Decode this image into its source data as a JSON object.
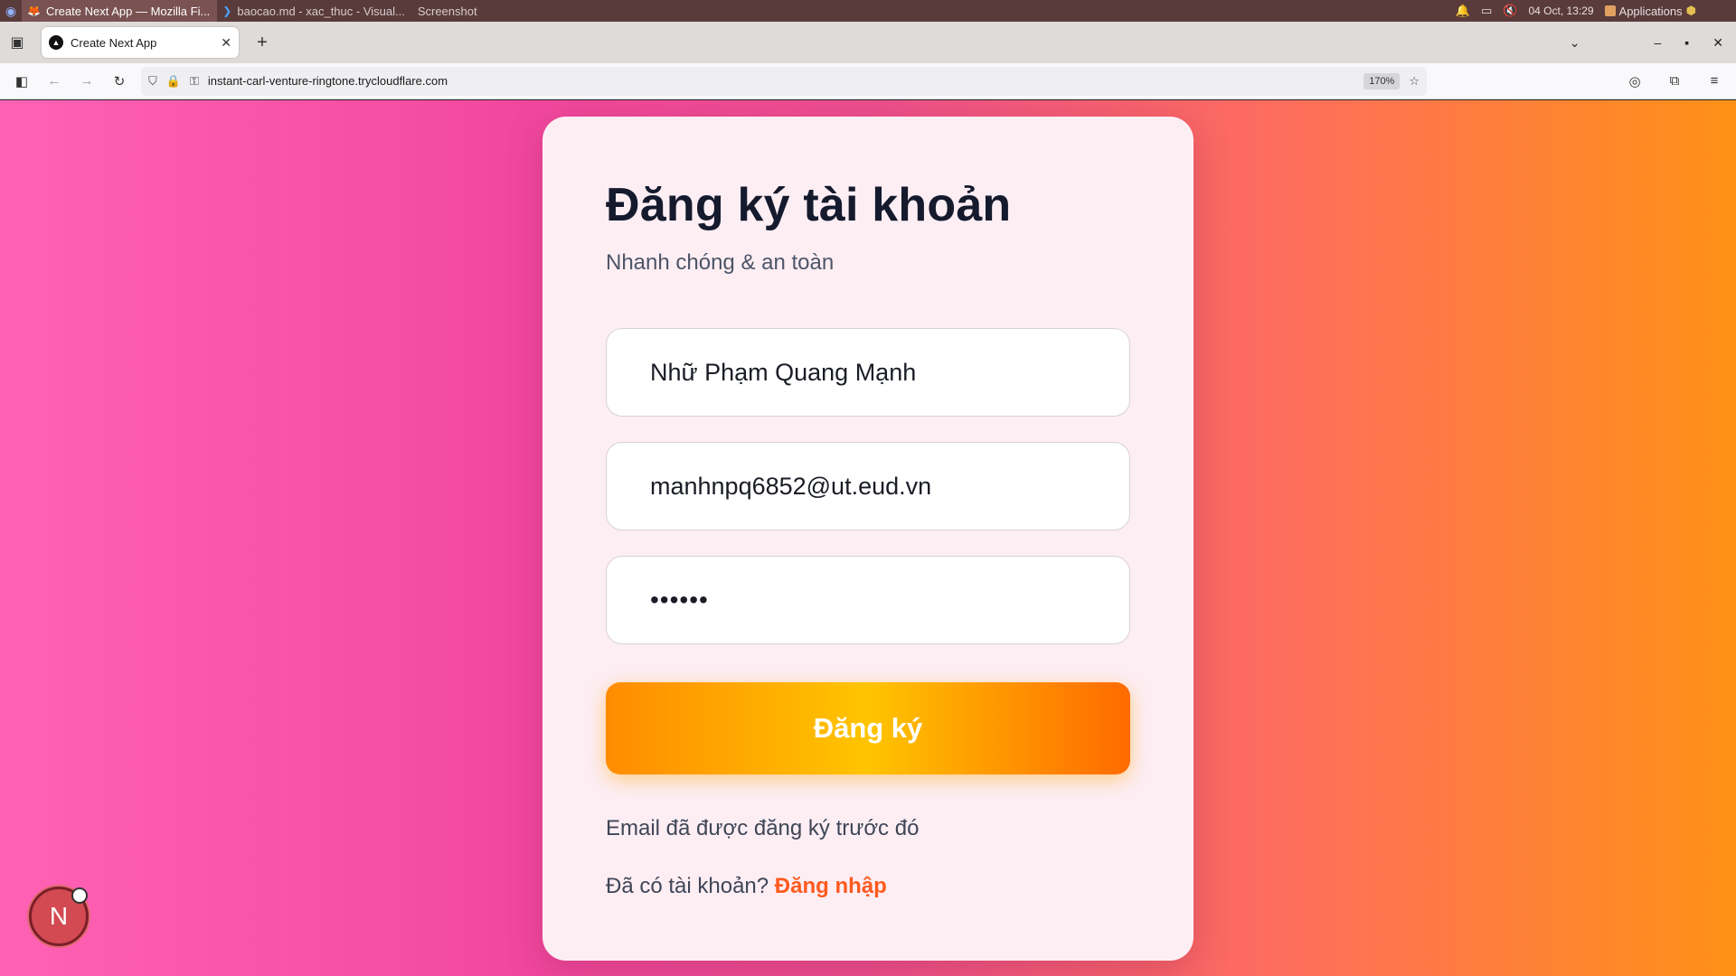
{
  "os_panel": {
    "tasks": [
      {
        "label": "Create Next App — Mozilla Fi...",
        "active": true
      },
      {
        "label": "baocao.md - xac_thuc - Visual...",
        "active": false
      },
      {
        "label": "Screenshot",
        "active": false
      }
    ],
    "datetime": "04 Oct, 13:29",
    "applications_label": "Applications"
  },
  "browser": {
    "tab_title": "Create Next App",
    "tab_favicon": "▲",
    "url": "instant-carl-venture-ringtone.trycloudflare.com",
    "zoom": "170%"
  },
  "form": {
    "title": "Đăng ký tài khoản",
    "subtitle": "Nhanh chóng & an toàn",
    "name_value": "Nhữ Phạm Quang Mạnh",
    "email_value": "manhnpq6852@ut.eud.vn",
    "password_value": "••••••",
    "submit_label": "Đăng ký",
    "error_message": "Email đã được đăng ký trước đó",
    "login_prompt": "Đã có tài khoản?",
    "login_link": "Đăng nhập"
  },
  "dev_badge": {
    "letter": "N"
  },
  "colors": {
    "accent": "#ff5a1f",
    "button_start": "#ff8c00",
    "button_mid": "#ffc400",
    "bg_left": "#ff62b5",
    "bg_right": "#ff9116"
  }
}
